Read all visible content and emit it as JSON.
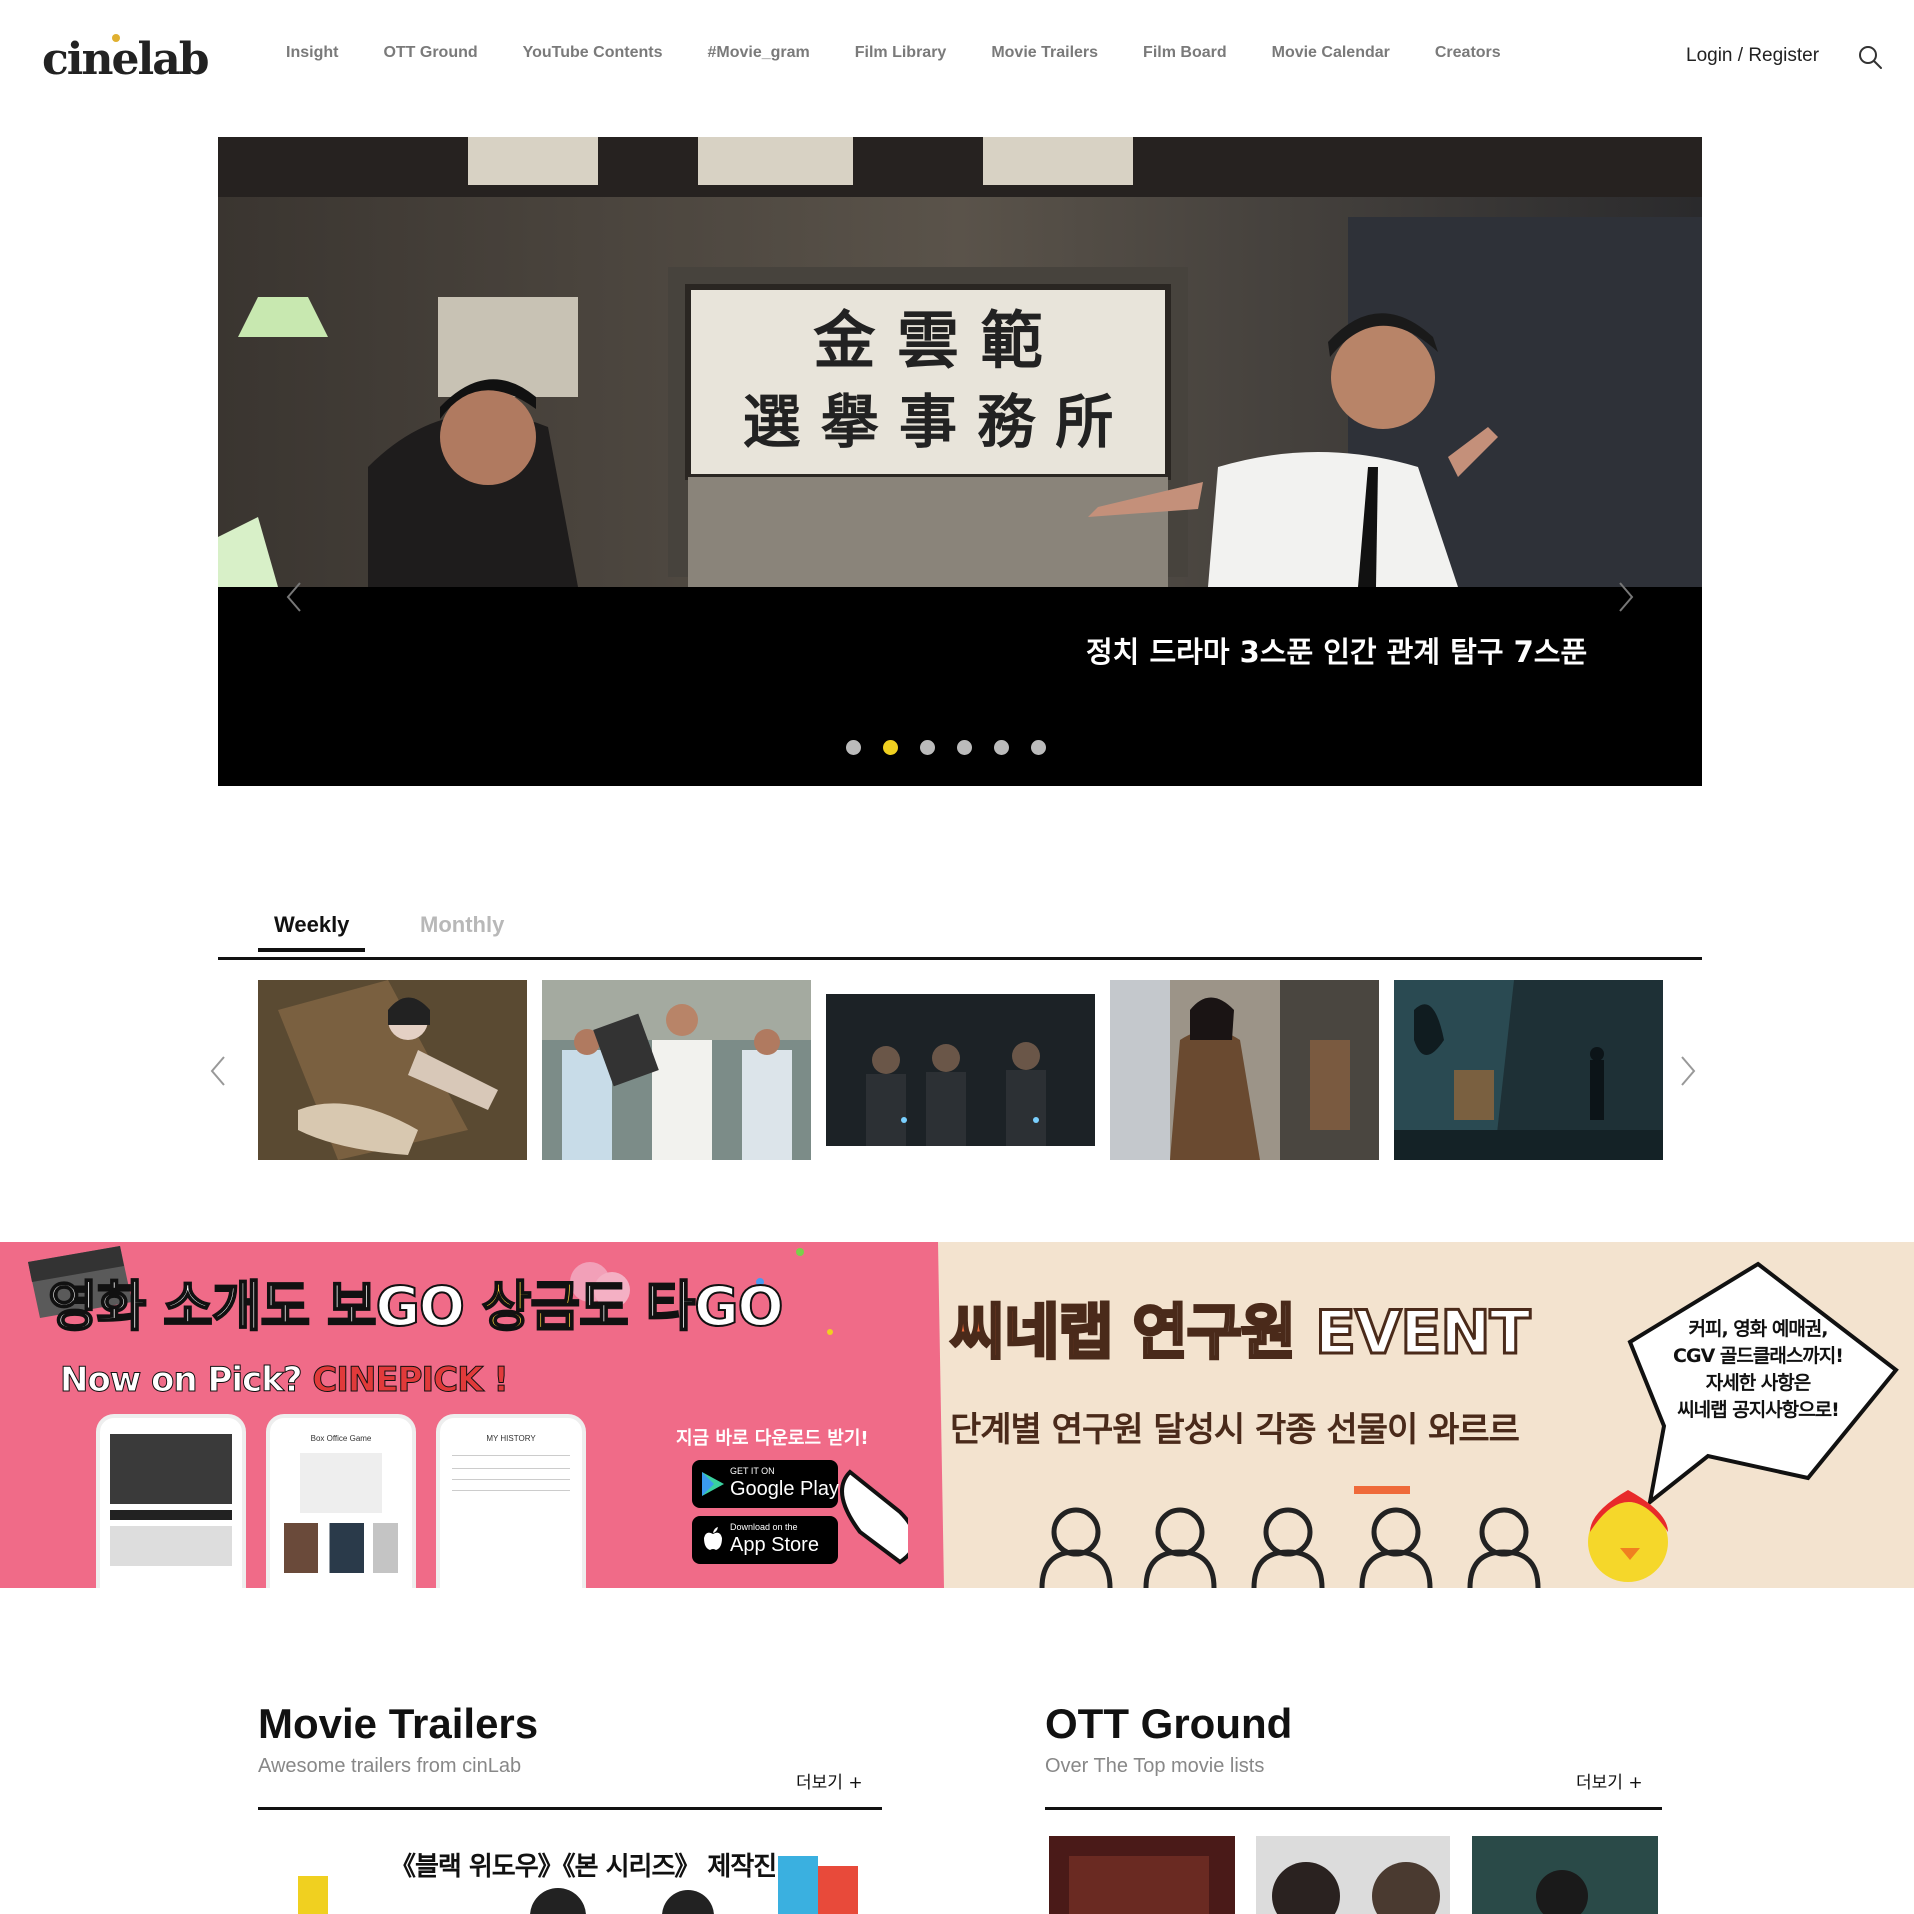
{
  "header": {
    "logo": "cinelab",
    "nav": [
      "Insight",
      "OTT Ground",
      "YouTube Contents",
      "#Movie_gram",
      "Film Library",
      "Movie Trailers",
      "Film Board",
      "Movie Calendar",
      "Creators"
    ],
    "login_label": "Login / Register"
  },
  "hero": {
    "caption": "정치 드라마 3스푼 인간 관계 탐구 7스푼",
    "slide_count": 6,
    "active_slide": 2,
    "sign_line1": "金 雲 範",
    "sign_line2": "選 擧 事 務 所"
  },
  "ranking": {
    "tabs": [
      "Weekly",
      "Monthly"
    ],
    "active_tab": "Weekly",
    "thumb_count": 5
  },
  "banner_left": {
    "title_a": "영화 소개도 보GO ",
    "title_b": "상금",
    "title_c": "도 타GO",
    "subtitle_a": "Now on Pick? ",
    "subtitle_b": "CINEPICK !",
    "phone1_header": "",
    "phone2_header": "Box Office Game",
    "phone3_header": "MY HISTORY",
    "download_text": "지금 바로 다운로드 받기!",
    "google_small": "GET IT ON",
    "google_big": "Google Play",
    "apple_small": "Download on the",
    "apple_big": "App Store"
  },
  "banner_right": {
    "title_a": "씨네랩",
    "title_b": " 연구원 EVENT",
    "subtitle": "단계별 연구원 달성시 각종 선물이 와르르",
    "bubble_line1": "커피, 영화 예매권,",
    "bubble_line2": "CGV 골드클래스까지!",
    "bubble_line3": "자세한 사항은",
    "bubble_line4": "씨네랩 공지사항으로!"
  },
  "sections": {
    "trailers": {
      "title": "Movie Trailers",
      "subtitle": "Awesome trailers from cinLab",
      "more": "더보기 +",
      "preview_text": "《블랙 위도우》《본 시리즈》 제작진"
    },
    "ott": {
      "title": "OTT Ground",
      "subtitle": "Over The Top movie lists",
      "more": "더보기 +"
    }
  },
  "colors": {
    "accent_yellow": "#f0d020",
    "banner_pink": "#f06b88",
    "banner_beige": "#f3e3cf"
  }
}
